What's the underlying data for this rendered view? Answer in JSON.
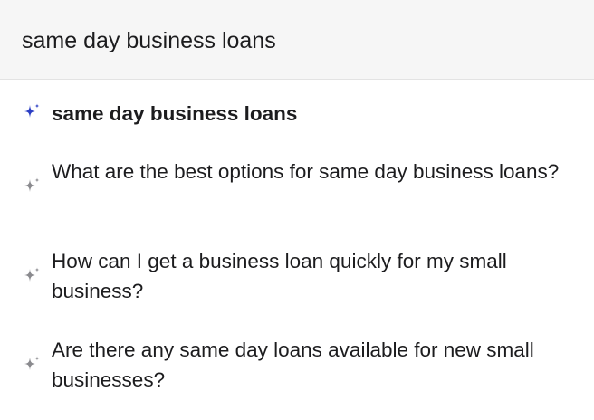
{
  "search": {
    "value": "same day business loans"
  },
  "suggestions": [
    {
      "text": "same day business loans",
      "icon": "sparkle-icon",
      "icon_color": "#2b3ec4",
      "bold": true
    },
    {
      "text": "What are the best options for same day business loans?",
      "icon": "sparkle-icon",
      "icon_color": "#8a8a8e",
      "bold": false
    },
    {
      "text": "How can I get a business loan quickly for my small business?",
      "icon": "sparkle-icon",
      "icon_color": "#8a8a8e",
      "bold": false
    },
    {
      "text": "Are there any same day loans available for new small businesses?",
      "icon": "sparkle-icon",
      "icon_color": "#8a8a8e",
      "bold": false
    }
  ]
}
